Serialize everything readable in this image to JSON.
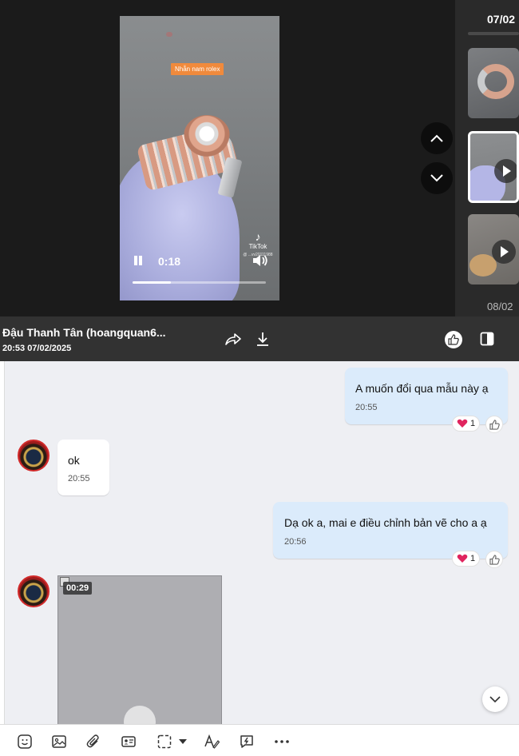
{
  "viewer": {
    "video_tag": "Nhẫn nam rolex",
    "video_time": "0:18",
    "progress": 0.29,
    "tiktok_label": "TikTok",
    "tiktok_handle": "@ ...vv20111988",
    "thumb_dates": [
      "07/02",
      "08/02"
    ]
  },
  "info_bar": {
    "sender_name": "Đậu Thanh Tân (hoangquan6...",
    "sent_time": "20:53 07/02/2025"
  },
  "messages": [
    {
      "text": "A muốn đổi qua mẫu này ạ",
      "time": "20:55",
      "reaction_count": "1"
    },
    {
      "text": "ok",
      "time": "20:55"
    },
    {
      "text": "Dạ ok a, mai e điều chỉnh bản vẽ cho a ạ",
      "time": "20:56",
      "reaction_count": "1"
    }
  ],
  "video_message": {
    "duration": "00:29"
  },
  "icons": {
    "heart": "heart-icon",
    "like": "thumbs-up-icon",
    "share": "share-icon",
    "download": "download-icon",
    "panel": "panel-toggle-icon"
  },
  "colors": {
    "outgoing_bubble": "#dbebfb",
    "incoming_bubble": "#ffffff",
    "heart": "#e0245e",
    "viewer_bg": "#1b1b1b",
    "info_bar_bg": "#323232"
  }
}
